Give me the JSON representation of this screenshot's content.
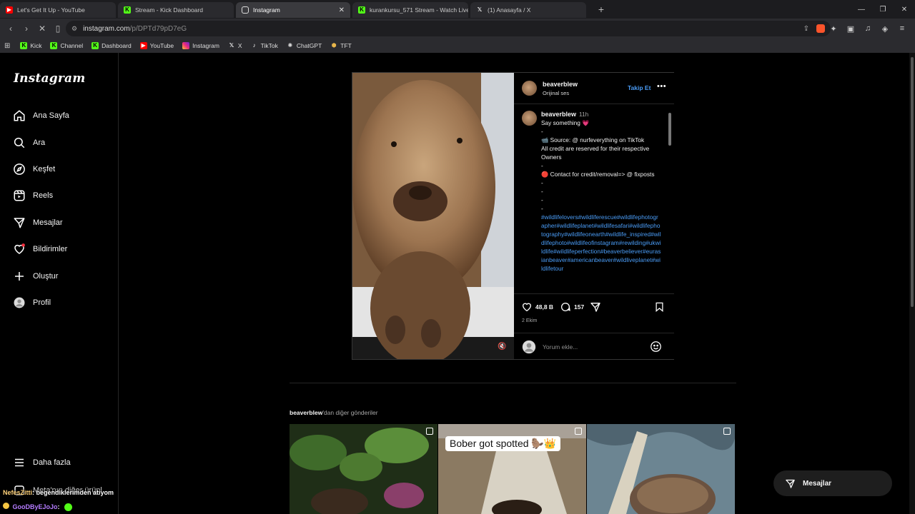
{
  "browser": {
    "tabs": [
      {
        "title": "Let's Get It Up - YouTube",
        "icon": "youtube-icon",
        "color": "#ff0000"
      },
      {
        "title": "Stream - Kick Dashboard",
        "icon": "kick-icon",
        "color": "#53fc18"
      },
      {
        "title": "Instagram",
        "icon": "instagram-icon",
        "active": true
      },
      {
        "title": "kurankursu_571 Stream - Watch Live",
        "icon": "kick-icon",
        "color": "#53fc18"
      },
      {
        "title": "(1) Anasayfa / X",
        "icon": "x-icon"
      }
    ],
    "url_host": "instagram.com",
    "url_path": "/p/DPTd79pD7eG",
    "bookmarks": [
      {
        "label": "Kick",
        "icon": "kick-icon"
      },
      {
        "label": "Channel",
        "icon": "kick-icon"
      },
      {
        "label": "Dashboard",
        "icon": "kick-icon"
      },
      {
        "label": "YouTube",
        "icon": "youtube-icon"
      },
      {
        "label": "Instagram",
        "icon": "instagram-icon"
      },
      {
        "label": "X",
        "icon": "x-icon"
      },
      {
        "label": "TikTok",
        "icon": "tiktok-icon"
      },
      {
        "label": "ChatGPT",
        "icon": "chatgpt-icon"
      },
      {
        "label": "TFT",
        "icon": "tft-icon"
      }
    ]
  },
  "sidebar": {
    "logo": "Instagram",
    "items": [
      {
        "label": "Ana Sayfa",
        "icon": "home-icon"
      },
      {
        "label": "Ara",
        "icon": "search-icon"
      },
      {
        "label": "Keşfet",
        "icon": "compass-icon"
      },
      {
        "label": "Reels",
        "icon": "reels-icon"
      },
      {
        "label": "Mesajlar",
        "icon": "messenger-icon"
      },
      {
        "label": "Bildirimler",
        "icon": "heart-icon"
      },
      {
        "label": "Oluştur",
        "icon": "plus-icon"
      },
      {
        "label": "Profil",
        "icon": "profile-avatar"
      }
    ],
    "more_label": "Daha fazla",
    "meta_label": "Meta'nın diğer ürünl"
  },
  "post": {
    "username": "beaverblew",
    "audio": "Orijinal ses",
    "follow_label": "Takip Et",
    "caption_time": "11h",
    "caption_lines": [
      "Say something 💗",
      "-",
      "📹 Source: @ nurfeverything on TikTok",
      "All credit are reserved for their respective Owners",
      "-",
      "🔴 Contact for credit/removal=> @ fixposts",
      "-",
      "-",
      "-",
      "-"
    ],
    "hashtags": "#wildlifelovers#wildliferescue#wildlifephotographer#wildlifeplanet#wildlifesafari#wildlifephotography#wildlifeonearth#wildlife_inspired#wildlifephoto#wildlifeofinstagram#rewilding#ukwildlife#wildlifeperfection#beaverbeliever#eurasianbeaver#americanbeaver#wildliveplanet#wildlifetour",
    "likes": "48,8 B",
    "comments": "157",
    "date": "2 Ekim",
    "comment_placeholder": "Yorum ekle..."
  },
  "more_posts": {
    "username": "beaverblew",
    "suffix": "'dan diğer gönderiler",
    "items": [
      {
        "caption": ""
      },
      {
        "caption": "Bober got spotted 🦫👑"
      },
      {
        "caption": ""
      }
    ]
  },
  "messages_fab": "Mesajlar",
  "stream_chat": [
    {
      "user": "NefesZitti",
      "text": ": begendiklerimden atıyom"
    },
    {
      "user": "GooDByEJoJo",
      "text": ":"
    }
  ]
}
